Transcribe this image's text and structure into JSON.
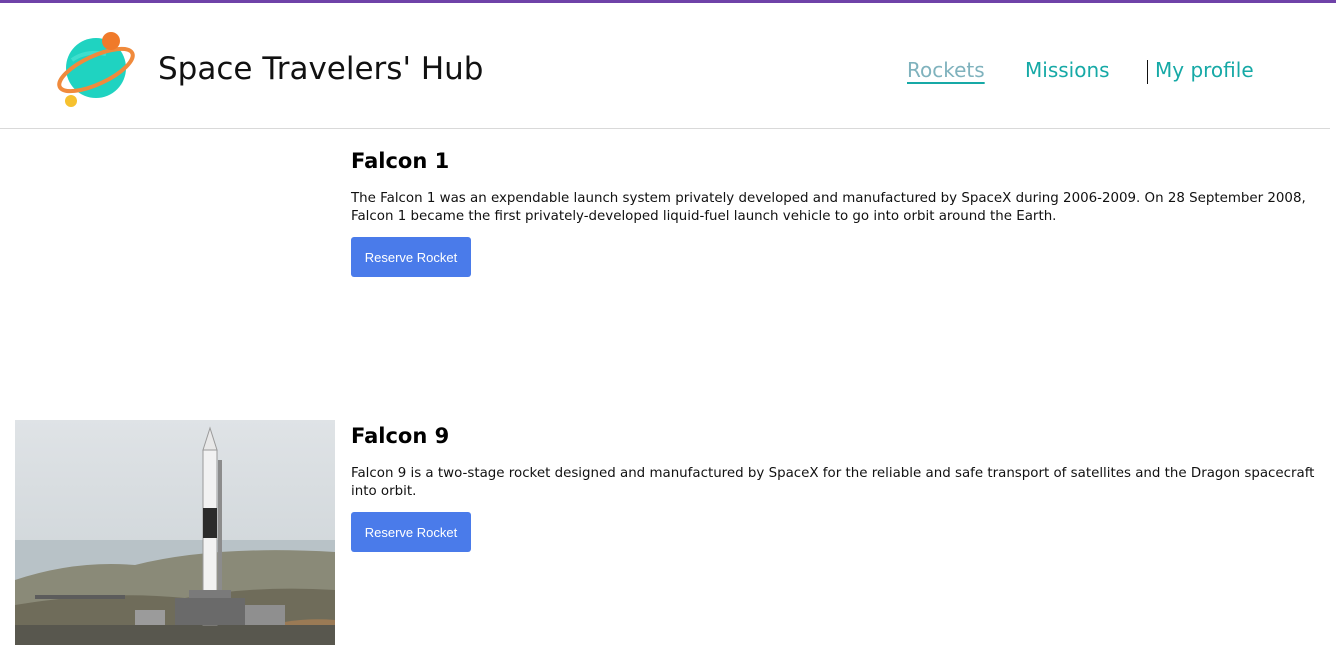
{
  "header": {
    "title": "Space Travelers' Hub",
    "logo_icon": "planet-logo-icon"
  },
  "nav": {
    "items": [
      {
        "label": "Rockets",
        "active": true
      },
      {
        "label": "Missions",
        "active": false
      },
      {
        "label": "My profile",
        "active": false
      }
    ]
  },
  "rockets": [
    {
      "name": "Falcon 1",
      "description": "The Falcon 1 was an expendable launch system privately developed and manufactured by SpaceX during 2006-2009. On 28 September 2008, Falcon 1 became the first privately-developed liquid-fuel launch vehicle to go into orbit around the Earth.",
      "button_label": "Reserve Rocket",
      "image": "none"
    },
    {
      "name": "Falcon 9",
      "description": "Falcon 9 is a two-stage rocket designed and manufactured by SpaceX for the reliable and safe transport of satellites and the Dragon spacecraft into orbit.",
      "button_label": "Reserve Rocket",
      "image": "rocket-launchpad-photo"
    }
  ],
  "colors": {
    "accent": "#16a9a6",
    "button": "#4a7bea",
    "topbar": "#6f42a8"
  }
}
